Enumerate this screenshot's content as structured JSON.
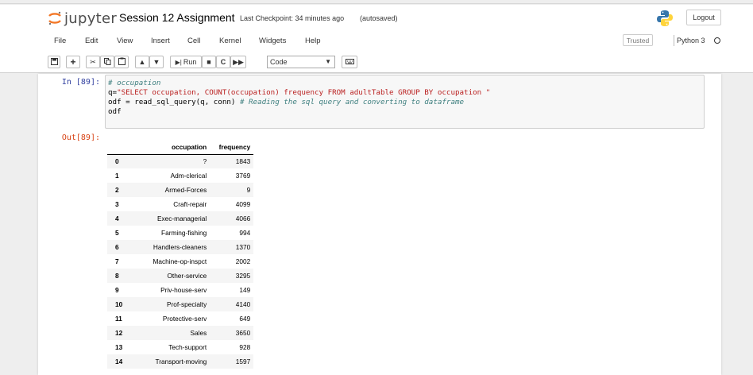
{
  "header": {
    "logo_text": "jupyter",
    "notebook_title": "Session 12 Assignment",
    "checkpoint": "Last Checkpoint: 34 minutes ago",
    "autosave_status": "(autosaved)",
    "logout_label": "Logout"
  },
  "menu": {
    "items": [
      "File",
      "Edit",
      "View",
      "Insert",
      "Cell",
      "Kernel",
      "Widgets",
      "Help"
    ],
    "trusted_label": "Trusted",
    "kernel_name": "Python 3"
  },
  "toolbar": {
    "run_label": "Run",
    "cell_type": "Code"
  },
  "cell": {
    "in_prompt": "In [89]:",
    "code_comment": "# occupation",
    "code_line2_prefix": "q=",
    "code_line2_string": "\"SELECT occupation, COUNT(occupation) frequency FROM adultTable GROUP BY occupation \"",
    "code_line3_code": "odf = read_sql_query(q, conn) ",
    "code_line3_comment": "# Reading the sql query and converting to dataframe",
    "code_line4": "odf",
    "out_prompt": "Out[89]:"
  },
  "output_table": {
    "columns": [
      "occupation",
      "frequency"
    ],
    "rows": [
      {
        "index": "0",
        "occupation": "?",
        "frequency": "1843"
      },
      {
        "index": "1",
        "occupation": "Adm-clerical",
        "frequency": "3769"
      },
      {
        "index": "2",
        "occupation": "Armed-Forces",
        "frequency": "9"
      },
      {
        "index": "3",
        "occupation": "Craft-repair",
        "frequency": "4099"
      },
      {
        "index": "4",
        "occupation": "Exec-managerial",
        "frequency": "4066"
      },
      {
        "index": "5",
        "occupation": "Farming-fishing",
        "frequency": "994"
      },
      {
        "index": "6",
        "occupation": "Handlers-cleaners",
        "frequency": "1370"
      },
      {
        "index": "7",
        "occupation": "Machine-op-inspct",
        "frequency": "2002"
      },
      {
        "index": "8",
        "occupation": "Other-service",
        "frequency": "3295"
      },
      {
        "index": "9",
        "occupation": "Priv-house-serv",
        "frequency": "149"
      },
      {
        "index": "10",
        "occupation": "Prof-specialty",
        "frequency": "4140"
      },
      {
        "index": "11",
        "occupation": "Protective-serv",
        "frequency": "649"
      },
      {
        "index": "12",
        "occupation": "Sales",
        "frequency": "3650"
      },
      {
        "index": "13",
        "occupation": "Tech-support",
        "frequency": "928"
      },
      {
        "index": "14",
        "occupation": "Transport-moving",
        "frequency": "1597"
      }
    ]
  },
  "colors": {
    "in_prompt": "#303f9f",
    "out_prompt": "#d84315",
    "comment": "#408080",
    "string": "#ba2121",
    "logo_orange": "#f37726"
  },
  "icons": [
    "jupyter-logo-icon",
    "python-logo-icon",
    "save-icon",
    "add-cell-icon",
    "cut-icon",
    "copy-icon",
    "paste-icon",
    "move-up-icon",
    "move-down-icon",
    "run-icon",
    "stop-icon",
    "restart-icon",
    "fast-forward-icon",
    "keyboard-icon",
    "kernel-idle-icon"
  ]
}
